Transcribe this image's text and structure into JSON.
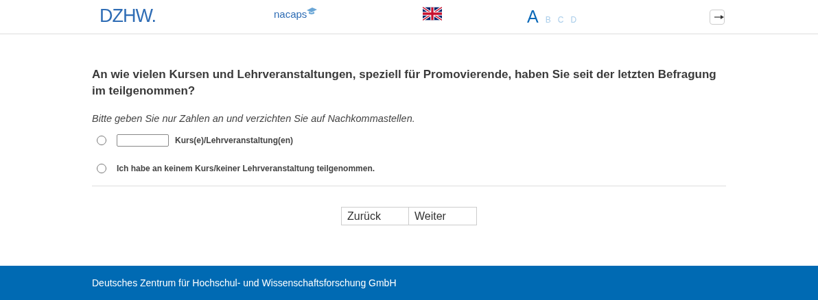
{
  "header": {
    "logo": "DZHW.",
    "partner_logo": "nacaps",
    "levels": [
      {
        "label": "A",
        "selected": true
      },
      {
        "label": "B",
        "selected": false
      },
      {
        "label": "C",
        "selected": false
      },
      {
        "label": "D",
        "selected": false
      }
    ]
  },
  "question": {
    "text": "An wie vielen Kursen und Lehrveranstaltungen, speziell für Promovierende, haben Sie seit der letzten Befragung im teilgenommen?",
    "instruction": "Bitte geben Sie nur Zahlen an und verzichten Sie auf Nachkommastellen.",
    "options": [
      {
        "kind": "number",
        "label": "Kurs(e)/Lehrveranstaltung(en)",
        "selected": false
      },
      {
        "kind": "plain",
        "label": "Ich habe an keinem Kurs/keiner Lehrveranstaltung teilgenommen.",
        "selected": false
      }
    ]
  },
  "buttons": [
    "Zurück",
    "Weiter"
  ],
  "footer": "Deutsches Zentrum für Hochschul- und Wissenschaftsforschung GmbH"
}
